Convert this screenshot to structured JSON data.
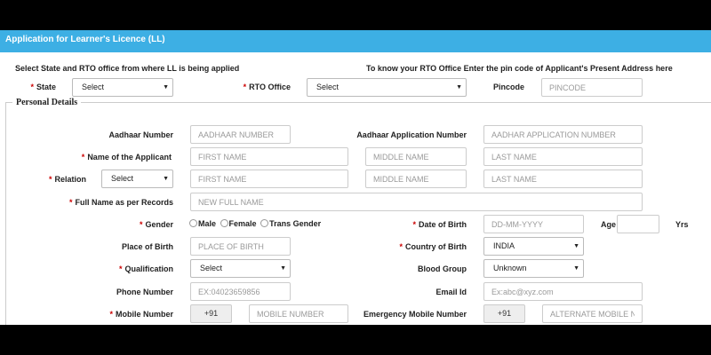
{
  "header": {
    "title": "Application for Learner's Licence (LL)"
  },
  "intro": {
    "left_text": "Select State and RTO office from where LL is being applied",
    "right_text": "To know your RTO Office Enter the pin code of Applicant's Present Address here"
  },
  "top_row": {
    "state_label": "State",
    "state_value": "Select",
    "rto_label": "RTO Office",
    "rto_value": "Select",
    "pincode_label": "Pincode",
    "pincode_placeholder": "PINCODE"
  },
  "personal": {
    "legend": "Personal Details",
    "aadhaar_label": "Aadhaar Number",
    "aadhaar_placeholder": "AADHAAR NUMBER",
    "aadhaar_app_label": "Aadhaar Application Number",
    "aadhaar_app_placeholder": "AADHAR APPLICATION NUMBER",
    "name_label": "Name of the Applicant",
    "first_name_placeholder": "FIRST NAME",
    "middle_name_placeholder": "MIDDLE NAME",
    "last_name_placeholder": "LAST NAME",
    "relation_label": "Relation",
    "relation_value": "Select",
    "rel_first_placeholder": "FIRST NAME",
    "rel_middle_placeholder": "MIDDLE NAME",
    "rel_last_placeholder": "LAST NAME",
    "full_name_label": "Full Name as per Records",
    "full_name_placeholder": "NEW FULL NAME",
    "gender_label": "Gender",
    "gender_options": [
      "Male",
      "Female",
      "Trans Gender"
    ],
    "dob_label": "Date of Birth",
    "dob_placeholder": "DD-MM-YYYY",
    "age_label": "Age",
    "age_unit": "Yrs",
    "pob_label": "Place of Birth",
    "pob_placeholder": "PLACE OF BIRTH",
    "country_label": "Country of Birth",
    "country_value": "INDIA",
    "qualification_label": "Qualification",
    "qualification_value": "Select",
    "blood_group_label": "Blood Group",
    "blood_group_value": "Unknown",
    "phone_label": "Phone Number",
    "phone_placeholder": "EX:04023659856",
    "email_label": "Email Id",
    "email_placeholder": "Ex:abc@xyz.com",
    "mobile_label": "Mobile Number",
    "mobile_prefix": "+91",
    "mobile_placeholder": "MOBILE NUMBER",
    "emergency_label": "Emergency Mobile Number",
    "emergency_prefix": "+91",
    "emergency_placeholder": "ALTERNATE MOBILE NI"
  },
  "icons": {
    "dropdown": "caret-down-icon",
    "radio": "radio-icon"
  },
  "colors": {
    "header_bg": "#3dafe4",
    "required": "#cc0000"
  }
}
